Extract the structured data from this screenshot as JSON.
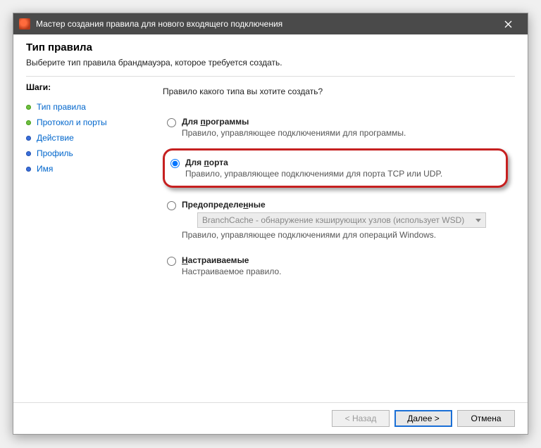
{
  "titlebar": {
    "title": "Мастер создания правила для нового входящего подключения"
  },
  "header": {
    "title": "Тип правила",
    "subtitle": "Выберите тип правила брандмауэра, которое требуется создать."
  },
  "steps": {
    "heading": "Шаги:",
    "items": [
      {
        "label": "Тип правила",
        "state": "current"
      },
      {
        "label": "Протокол и порты",
        "state": "current"
      },
      {
        "label": "Действие",
        "state": "other"
      },
      {
        "label": "Профиль",
        "state": "other"
      },
      {
        "label": "Имя",
        "state": "other"
      }
    ]
  },
  "content": {
    "prompt": "Правило какого типа вы хотите создать?",
    "options": [
      {
        "id": "program",
        "title_pre": "Для ",
        "title_ul": "п",
        "title_post": "рограммы",
        "desc": "Правило, управляющее подключениями для программы.",
        "selected": false,
        "highlight": false
      },
      {
        "id": "port",
        "title_pre": "Для ",
        "title_ul": "п",
        "title_post": "орта",
        "desc": "Правило, управляющее подключениями для порта TCP или UDP.",
        "selected": true,
        "highlight": true
      },
      {
        "id": "predefined",
        "title_pre": "Предопределе",
        "title_ul": "н",
        "title_post": "ные",
        "desc": "Правило, управляющее подключениями для операций Windows.",
        "selected": false,
        "highlight": false,
        "combo": "BranchCache - обнаружение кэширующих узлов (использует WSD)"
      },
      {
        "id": "custom",
        "title_pre": "",
        "title_ul": "Н",
        "title_post": "астраиваемые",
        "desc": "Настраиваемое правило.",
        "selected": false,
        "highlight": false
      }
    ]
  },
  "footer": {
    "back": "< Назад",
    "next": "Далее >",
    "cancel": "Отмена"
  }
}
